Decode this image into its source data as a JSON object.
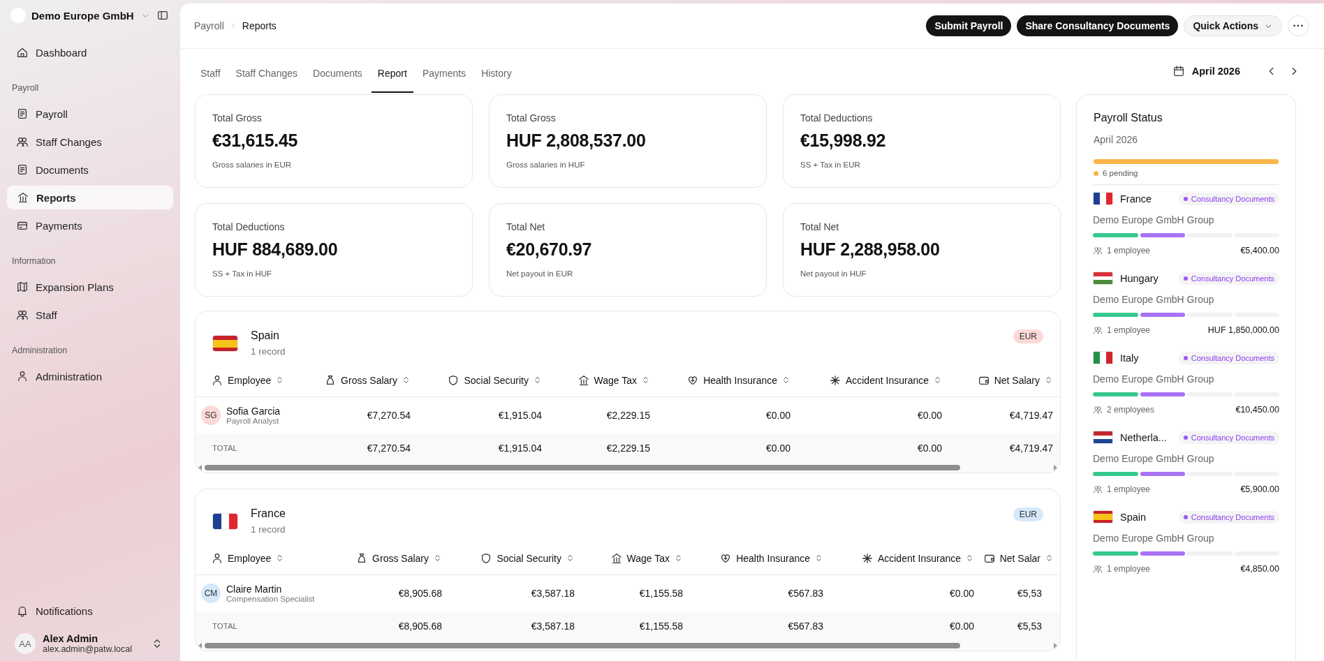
{
  "sidebar": {
    "org": "Demo Europe GmbH",
    "items": [
      {
        "kind": "item",
        "label": "Dashboard",
        "selected": false
      },
      {
        "kind": "section",
        "label": "Payroll"
      },
      {
        "kind": "item",
        "label": "Payroll",
        "selected": false
      },
      {
        "kind": "item",
        "label": "Staff Changes",
        "selected": false
      },
      {
        "kind": "item",
        "label": "Documents",
        "selected": false
      },
      {
        "kind": "item",
        "label": "Reports",
        "selected": true
      },
      {
        "kind": "item",
        "label": "Payments",
        "selected": false
      },
      {
        "kind": "section",
        "label": "Information"
      },
      {
        "kind": "item",
        "label": "Expansion Plans",
        "selected": false
      },
      {
        "kind": "item",
        "label": "Staff",
        "selected": false
      },
      {
        "kind": "section",
        "label": "Administration"
      },
      {
        "kind": "item",
        "label": "Administration",
        "selected": false
      }
    ],
    "notifications": "Notifications",
    "user": {
      "initials": "AA",
      "name": "Alex Admin",
      "email": "alex.admin@patw.local"
    }
  },
  "breadcrumb": [
    "Payroll",
    "Reports"
  ],
  "actions": [
    {
      "kind": "primary",
      "label": "Submit Payroll"
    },
    {
      "kind": "primary",
      "label": "Share Consultancy Documents"
    },
    {
      "kind": "dropdown",
      "label": "Quick Actions"
    },
    {
      "kind": "more"
    }
  ],
  "tabs": [
    {
      "label": "Staff",
      "selected": false
    },
    {
      "label": "Staff Changes",
      "selected": false
    },
    {
      "label": "Documents",
      "selected": false
    },
    {
      "label": "Report",
      "selected": true
    },
    {
      "label": "Payments",
      "selected": false
    },
    {
      "label": "History",
      "selected": false
    }
  ],
  "period": "April 2026",
  "stats": [
    {
      "title": "Total Gross",
      "value": "€31,615.45",
      "note": "Gross salaries in EUR"
    },
    {
      "title": "Total Gross",
      "value": "HUF 2,808,537.00",
      "note": "Gross salaries in HUF"
    },
    {
      "title": "Total Deductions",
      "value": "€15,998.92",
      "note": "SS + Tax in EUR"
    },
    {
      "title": "Total Deductions",
      "value": "HUF 884,689.00",
      "note": "SS + Tax in HUF"
    },
    {
      "title": "Total Net",
      "value": "€20,670.97",
      "note": "Net payout in EUR"
    },
    {
      "title": "Total Net",
      "value": "HUF 2,288,958.00",
      "note": "Net payout in HUF"
    }
  ],
  "country_tables": [
    {
      "kind": "es",
      "country": "Spain",
      "records": "1 record",
      "currency": {
        "label": "EUR",
        "color": "#fcd9d6"
      },
      "columns": [
        "Employee",
        "Gross Salary",
        "Social Security",
        "Wage Tax",
        "Health Insurance",
        "Accident Insurance",
        "Net Salary"
      ],
      "rows": [
        {
          "cells": [
            {
              "initials": "SG",
              "color": "#fcd9d6",
              "name": "Sofia Garcia",
              "role": "Payroll Analyst"
            },
            "€7,270.54",
            "€1,915.04",
            "€2,229.15",
            "€0.00",
            "€0.00",
            "€4,719.47"
          ]
        },
        {
          "cells": [
            "TOTAL",
            "€7,270.54",
            "€1,915.04",
            "€2,229.15",
            "€0.00",
            "€0.00",
            "€4,719.47"
          ]
        }
      ]
    },
    {
      "kind": "fr",
      "country": "France",
      "records": "1 record",
      "currency": {
        "label": "EUR",
        "color": "#d6e9fb"
      },
      "columns": [
        "Employee",
        "Gross Salary",
        "Social Security",
        "Wage Tax",
        "Health Insurance",
        "Accident Insurance",
        "Net Salar"
      ],
      "rows": [
        {
          "cells": [
            {
              "initials": "CM",
              "color": "#d6e9fb",
              "name": "Claire Martin",
              "role": "Compensation Specialist"
            },
            "€8,905.68",
            "€3,587.18",
            "€1,155.58",
            "€567.83",
            "€0.00",
            "€5,53"
          ]
        },
        {
          "cells": [
            "TOTAL",
            "€8,905.68",
            "€3,587.18",
            "€1,155.58",
            "€567.83",
            "€0.00",
            "€5,53"
          ]
        }
      ]
    }
  ],
  "payroll_status": {
    "title": "Payroll Status",
    "period": "April 2026",
    "level": 1,
    "pending": {
      "label": "6 pending",
      "color": "#fbb64b"
    },
    "items": [
      {
        "kind": "fr",
        "country": "France",
        "badge": "Consultancy Documents",
        "group": "Demo Europe GmbH Group",
        "level": 0.5,
        "employees": "1 employee",
        "amount": "€5,400.00"
      },
      {
        "kind": "hu",
        "country": "Hungary",
        "badge": "Consultancy Documents",
        "group": "Demo Europe GmbH Group",
        "level": 0.5,
        "employees": "1 employee",
        "amount": "HUF 1,850,000.00"
      },
      {
        "kind": "it",
        "country": "Italy",
        "badge": "Consultancy Documents",
        "group": "Demo Europe GmbH Group",
        "level": 0.5,
        "employees": "2 employees",
        "amount": "€10,450.00"
      },
      {
        "kind": "nl",
        "country": "Netherla...",
        "badge": "Consultancy Documents",
        "group": "Demo Europe GmbH Group",
        "level": 0.5,
        "employees": "1 employee",
        "amount": "€5,900.00"
      },
      {
        "kind": "es",
        "country": "Spain",
        "badge": "Consultancy Documents",
        "group": "Demo Europe GmbH Group",
        "level": 0.5,
        "employees": "1 employee",
        "amount": "€4,850.00"
      }
    ]
  }
}
